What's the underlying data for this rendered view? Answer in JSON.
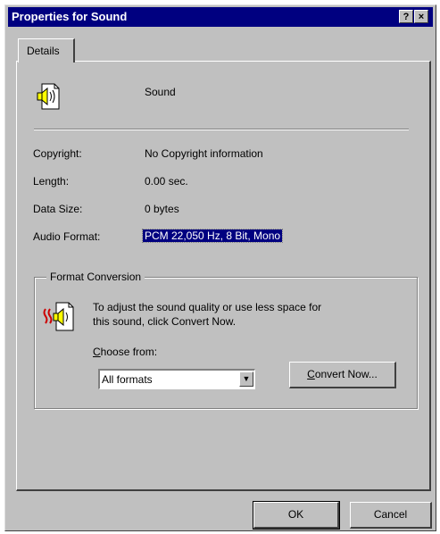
{
  "window": {
    "title": "Properties for Sound",
    "help_label": "?",
    "close_label": "×"
  },
  "tabs": [
    {
      "label": "Details"
    }
  ],
  "details": {
    "name": "Sound",
    "copyright_label": "Copyright:",
    "copyright_value": "No Copyright information",
    "length_label": "Length:",
    "length_value": "0.00 sec.",
    "datasize_label": "Data Size:",
    "datasize_value": "0 bytes",
    "format_label": "Audio Format:",
    "format_value": "PCM 22,050 Hz, 8 Bit, Mono"
  },
  "conversion": {
    "group_title": "Format Conversion",
    "description_line1": "To adjust the sound quality or use less space for",
    "description_line2": "this sound, click Convert Now.",
    "choose_from_label_rest": "hoose from:",
    "choose_from_access": "C",
    "selected_format": "All formats",
    "convert_button_access": "C",
    "convert_button_rest": "onvert Now..."
  },
  "buttons": {
    "ok": "OK",
    "cancel": "Cancel"
  },
  "icons": {
    "sound_file": "sound-file-icon",
    "convert": "sound-convert-icon",
    "dropdown": "chevron-down-icon"
  }
}
